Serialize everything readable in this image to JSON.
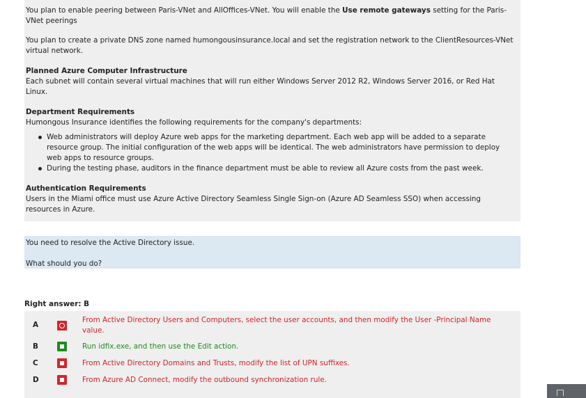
{
  "scenario": {
    "p1_before": "You plan to enable peering between Paris-VNet and AllOffices-VNet. You will enable the ",
    "p1_bold": "Use remote gateways",
    "p1_after": " setting for the Paris-VNet peerings",
    "p2": "You plan to create a private DNS zone named humongousinsurance.local and set the registration network to the ClientResources-VNet virtual network.",
    "infra_heading": "Planned Azure Computer Infrastructure",
    "infra_text": "Each subnet will contain several virtual machines that will run either Windows Server 2012 R2, Windows Server 2016, or Red Hat Linux.",
    "dept_heading": "Department Requirements",
    "dept_intro": "Humongous Insurance identifies the following requirements for the company's departments:",
    "dept_bullets": [
      "Web administrators will deploy Azure web apps for the marketing department. Each web app will be added to a separate resource group. The initial configuration of the web apps will be identical. The web administrators have permission to deploy web apps to resource groups.",
      "During the testing phase, auditors in the finance department must be able to review all Azure costs from the past week."
    ],
    "auth_heading": "Authentication Requirements",
    "auth_text": "Users in the Miami office must use Azure Active Directory Seamless Single Sign-on (Azure AD Seamless SSO) when accessing resources in Azure."
  },
  "question": {
    "line1": "You need to resolve the Active Directory issue.",
    "line2": "What should you do?"
  },
  "right_answer": "Right answer: B",
  "answers": [
    {
      "letter": "A",
      "text": "From Active Directory Users and Computers, select the user accounts, and then modify the User -Principal Name value.",
      "color": "#d4242a"
    },
    {
      "letter": "B",
      "text": "Run idfix.exe, and then use the Edit action.",
      "color": "#1f8a1f"
    },
    {
      "letter": "C",
      "text": "From Active Directory Domains and Trusts, modify the list of UPN suffixes.",
      "color": "#d4242a"
    },
    {
      "letter": "D",
      "text": "From Azure AD Connect, modify the outbound synchronization rule.",
      "color": "#d4242a"
    }
  ],
  "colors": {
    "wrong": "#d4242a",
    "correct": "#1f8a1f",
    "panel_gray": "#efefef",
    "panel_blue": "#dce8f2"
  },
  "icons": {
    "selected_answer": "radio-selected-icon",
    "correct_answer": "checkbox-correct-icon",
    "wrong_answer": "checkbox-wrong-icon",
    "corner": "print-icon"
  }
}
